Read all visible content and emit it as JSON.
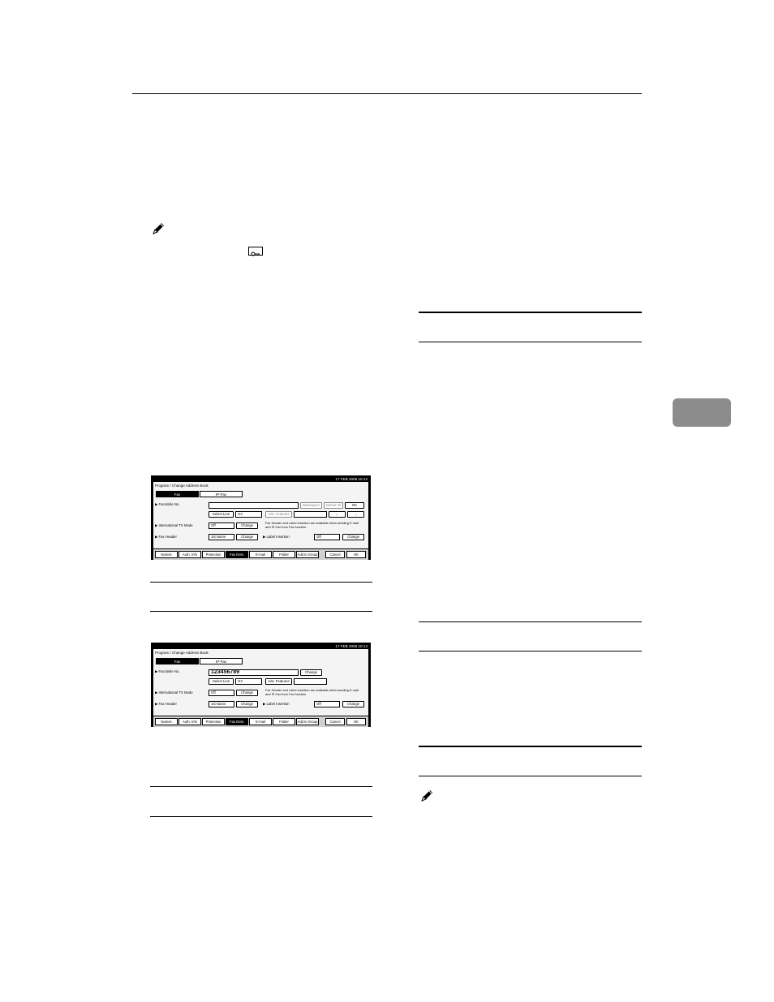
{
  "screen1": {
    "datetime": "17 FEB 2006 10:12",
    "title": "Program / Change Address Book",
    "tabs": [
      "Fax",
      "IP-Fax"
    ],
    "fax_label": "▶ Facsimile No.",
    "fax_value": "",
    "backspace": "Backspace",
    "delete_all": "Delete All",
    "ok_small": "OK",
    "select_line": "Select Line",
    "line_value": "G3",
    "adv_features": "Adv. Features",
    "left_arrow": "←",
    "right_arrow": "→",
    "intl_label": "▶ International TX Mode",
    "intl_value": "Off",
    "change": "Change",
    "note_line1": "Fax Header and Label Insertion are available when sending E-mail",
    "note_line2": "and IP-Fax from Fax function.",
    "header_label": "▶ Fax Header",
    "header_value": "1st Name",
    "label_insert": "▶ Label Insertion",
    "label_value": "Off",
    "bottom_tabs": [
      "Names",
      "Auth. Info",
      "Protection",
      "Fax Dest.",
      "E-mail",
      "Folder",
      "Add to Group"
    ],
    "cancel": "Cancel",
    "ok": "OK"
  },
  "screen2": {
    "datetime": "17 FEB 2006 10:14",
    "title": "Program / Change Address Book",
    "tabs": [
      "Fax",
      "IP-Fax"
    ],
    "fax_label": "▶ Facsimile No.",
    "fax_value": "123456789",
    "change_small": "Change",
    "select_line": "Select Line",
    "line_value": "G3",
    "adv_features": "Adv. Features",
    "intl_label": "▶ International TX Mode",
    "intl_value": "Off",
    "change": "Change",
    "note_line1": "Fax Header and Label Insertion are available when sending E-mail",
    "note_line2": "and IP-Fax from Fax function.",
    "header_label": "▶ Fax Header",
    "header_value": "1st Name",
    "label_insert": "▶ Label Insertion",
    "label_value": "Off",
    "bottom_tabs": [
      "Names",
      "Auth. Info",
      "Protection",
      "Fax Dest.",
      "E-mail",
      "Folder",
      "Add to Group"
    ],
    "cancel": "Cancel",
    "ok": "OK"
  }
}
